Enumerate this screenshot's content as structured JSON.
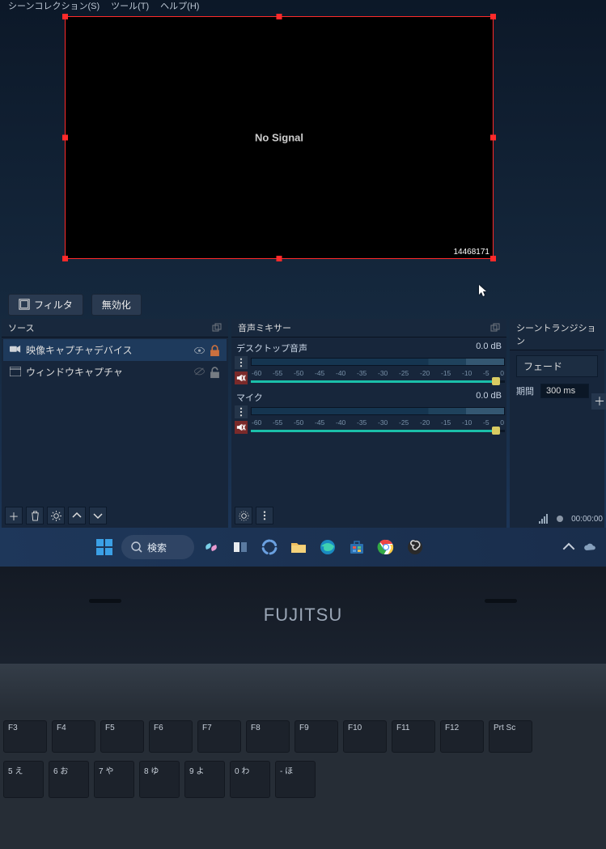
{
  "menubar": {
    "items": [
      "シーンコレクション(S)",
      "ツール(T)",
      "ヘルプ(H)"
    ]
  },
  "preview": {
    "message": "No Signal",
    "resolution_label": "14468171"
  },
  "toolbar": {
    "filter_label": "フィルタ",
    "disable_label": "無効化"
  },
  "sources": {
    "title": "ソース",
    "items": [
      {
        "icon": "camera",
        "label": "映像キャプチャデバイス",
        "selected": true,
        "visible": true,
        "locked": true
      },
      {
        "icon": "window",
        "label": "ウィンドウキャプチャ",
        "selected": false,
        "visible": false,
        "locked": false
      }
    ]
  },
  "mixer": {
    "title": "音声ミキサー",
    "channels": [
      {
        "name": "デスクトップ音声",
        "db": "0.0 dB",
        "muted": true
      },
      {
        "name": "マイク",
        "db": "0.0 dB",
        "muted": true
      }
    ],
    "ticks": [
      "-60",
      "-55",
      "-50",
      "-45",
      "-40",
      "-35",
      "-30",
      "-25",
      "-20",
      "-15",
      "-10",
      "-5",
      "0"
    ]
  },
  "transitions": {
    "title": "シーントランジション",
    "selected": "フェード",
    "duration_label": "期間",
    "duration_value": "300 ms"
  },
  "status": {
    "timer": "00:00:00"
  },
  "taskbar": {
    "search_placeholder": "検索"
  },
  "laptop": {
    "brand": "FUJITSU"
  },
  "keys_row1": [
    "F3",
    "F4",
    "F5",
    "F6",
    "F7",
    "F8",
    "F9",
    "F10",
    "F11",
    "F12",
    "Prt Sc"
  ],
  "keys_row2": [
    "5 え",
    "6 お",
    "7 や",
    "8 ゆ",
    "9 よ",
    "0 わ",
    "- ほ"
  ]
}
